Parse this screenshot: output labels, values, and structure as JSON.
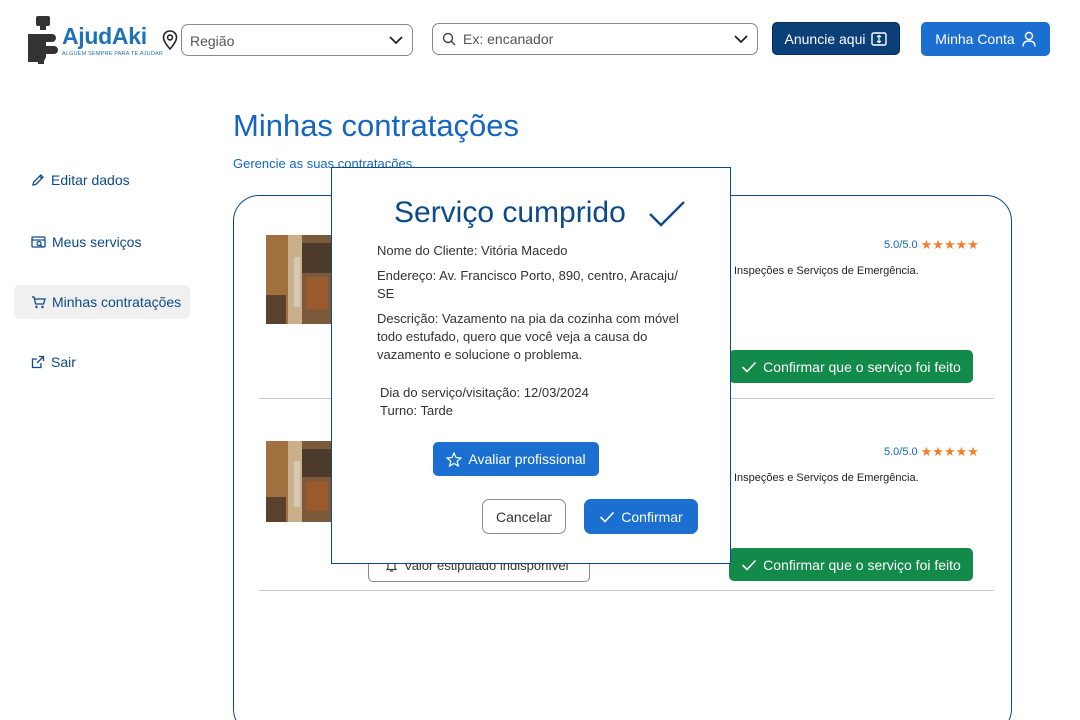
{
  "header": {
    "brand": "AjudAki",
    "tagline": "ALGUÉM SEMPRE PARA TE AJUDAR",
    "region_placeholder": "Região",
    "search_placeholder": "Ex: encanador",
    "anuncie_label": "Anuncie aqui",
    "account_label": "Minha Conta"
  },
  "sidebar": {
    "items": [
      {
        "label": "Editar dados",
        "icon": "pencil-icon"
      },
      {
        "label": "Meus serviços",
        "icon": "services-icon"
      },
      {
        "label": "Minhas contratações",
        "icon": "cart-icon",
        "active": true
      },
      {
        "label": "Sair",
        "icon": "external-link-icon"
      }
    ]
  },
  "main": {
    "title": "Minhas contratações",
    "subtitle": "Gerencie as suas contratações.",
    "cards": [
      {
        "rating": "5.0/5.0",
        "stars": 5,
        "description": "Inspeções e Serviços de Emergência.",
        "done_button": "Confirmar que o serviço foi feito"
      },
      {
        "rating": "5.0/5.0",
        "stars": 5,
        "description": "Inspeções e Serviços de Emergência.",
        "value_label": "Valor estipulado indisponível",
        "done_button": "Confirmar que o serviço foi feito"
      }
    ]
  },
  "modal": {
    "title": "Serviço cumprido",
    "client": "Nome do Cliente: Vitória Macedo",
    "address_line1": "Endereço: Av. Francisco Porto, 890, centro, Aracaju/",
    "address_line2": "SE",
    "description_line1": "Descrição: Vazamento na pia da cozinha com móvel",
    "description_line2": "todo estufado, quero que você veja a causa do",
    "description_line3": "vazamento e solucione o problema.",
    "date": "Dia do serviço/visitação: 12/03/2024",
    "shift": "Turno: Tarde",
    "rate_button": "Avaliar profissional",
    "cancel_button": "Cancelar",
    "confirm_button": "Confirmar"
  },
  "colors": {
    "primary": "#1a6fd1",
    "navy": "#0b3f78",
    "success": "#128a4a",
    "star": "#f07f2c"
  }
}
